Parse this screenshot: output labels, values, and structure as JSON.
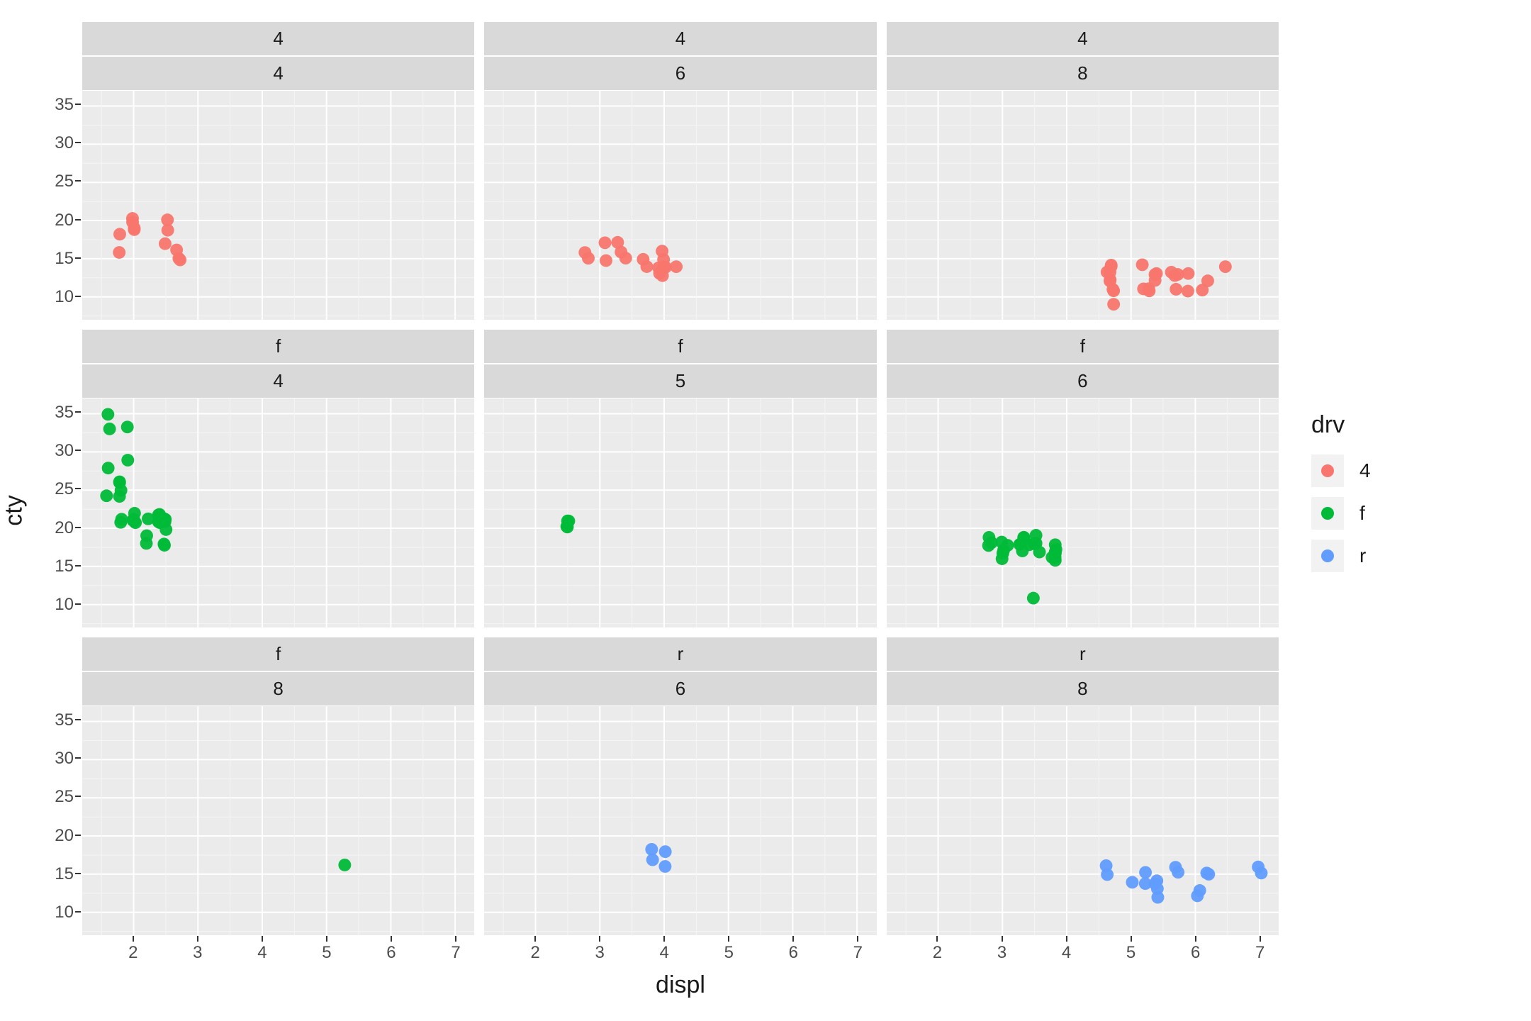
{
  "chart_data": {
    "type": "scatter",
    "xlabel": "displ",
    "ylabel": "cty",
    "xlim": [
      1.2,
      7.3
    ],
    "ylim": [
      7,
      37
    ],
    "x_ticks": [
      2,
      3,
      4,
      5,
      6,
      7
    ],
    "y_ticks": [
      10,
      15,
      20,
      25,
      30,
      35
    ],
    "colors": {
      "4": "#F8766D",
      "f": "#00BA38",
      "r": "#619CFF"
    },
    "legend": {
      "title": "drv",
      "items": [
        "4",
        "f",
        "r"
      ]
    },
    "facets": [
      {
        "row": 0,
        "col": 0,
        "strip": [
          "4",
          "4"
        ],
        "series": "4",
        "points": [
          {
            "x": 1.8,
            "y": 18
          },
          {
            "x": 1.8,
            "y": 16
          },
          {
            "x": 2.0,
            "y": 20
          },
          {
            "x": 2.0,
            "y": 19
          },
          {
            "x": 2.0,
            "y": 20
          },
          {
            "x": 2.0,
            "y": 19
          },
          {
            "x": 2.5,
            "y": 19
          },
          {
            "x": 2.5,
            "y": 20
          },
          {
            "x": 2.5,
            "y": 17
          },
          {
            "x": 2.7,
            "y": 15
          },
          {
            "x": 2.7,
            "y": 16
          },
          {
            "x": 2.7,
            "y": 15
          }
        ]
      },
      {
        "row": 0,
        "col": 1,
        "strip": [
          "4",
          "6"
        ],
        "series": "4",
        "points": [
          {
            "x": 2.8,
            "y": 15
          },
          {
            "x": 2.8,
            "y": 16
          },
          {
            "x": 3.1,
            "y": 15
          },
          {
            "x": 3.1,
            "y": 17
          },
          {
            "x": 3.3,
            "y": 17
          },
          {
            "x": 3.3,
            "y": 16
          },
          {
            "x": 3.4,
            "y": 15
          },
          {
            "x": 3.7,
            "y": 15
          },
          {
            "x": 3.7,
            "y": 14
          },
          {
            "x": 3.9,
            "y": 14
          },
          {
            "x": 3.9,
            "y": 13
          },
          {
            "x": 4.0,
            "y": 16
          },
          {
            "x": 4.0,
            "y": 14
          },
          {
            "x": 4.0,
            "y": 15
          },
          {
            "x": 4.0,
            "y": 14
          },
          {
            "x": 4.0,
            "y": 13
          },
          {
            "x": 4.2,
            "y": 14
          }
        ]
      },
      {
        "row": 0,
        "col": 2,
        "strip": [
          "4",
          "8"
        ],
        "series": "4",
        "points": [
          {
            "x": 4.6,
            "y": 13
          },
          {
            "x": 4.7,
            "y": 14
          },
          {
            "x": 4.7,
            "y": 13
          },
          {
            "x": 4.7,
            "y": 14
          },
          {
            "x": 4.7,
            "y": 9
          },
          {
            "x": 4.7,
            "y": 12
          },
          {
            "x": 4.7,
            "y": 11
          },
          {
            "x": 4.7,
            "y": 12
          },
          {
            "x": 4.7,
            "y": 11
          },
          {
            "x": 5.2,
            "y": 11
          },
          {
            "x": 5.2,
            "y": 14
          },
          {
            "x": 5.3,
            "y": 11
          },
          {
            "x": 5.3,
            "y": 11
          },
          {
            "x": 5.4,
            "y": 12
          },
          {
            "x": 5.4,
            "y": 13
          },
          {
            "x": 5.4,
            "y": 13
          },
          {
            "x": 5.6,
            "y": 13
          },
          {
            "x": 5.7,
            "y": 13
          },
          {
            "x": 5.7,
            "y": 11
          },
          {
            "x": 5.7,
            "y": 13
          },
          {
            "x": 5.9,
            "y": 11
          },
          {
            "x": 5.9,
            "y": 13
          },
          {
            "x": 6.1,
            "y": 11
          },
          {
            "x": 6.2,
            "y": 12
          },
          {
            "x": 6.5,
            "y": 14
          }
        ]
      },
      {
        "row": 1,
        "col": 0,
        "strip": [
          "f",
          "4"
        ],
        "series": "f",
        "points": [
          {
            "x": 1.6,
            "y": 24
          },
          {
            "x": 1.6,
            "y": 28
          },
          {
            "x": 1.6,
            "y": 33
          },
          {
            "x": 1.6,
            "y": 35
          },
          {
            "x": 1.8,
            "y": 21
          },
          {
            "x": 1.8,
            "y": 21
          },
          {
            "x": 1.8,
            "y": 24
          },
          {
            "x": 1.8,
            "y": 26
          },
          {
            "x": 1.8,
            "y": 25
          },
          {
            "x": 1.8,
            "y": 26
          },
          {
            "x": 1.9,
            "y": 29
          },
          {
            "x": 1.9,
            "y": 33
          },
          {
            "x": 2.0,
            "y": 21
          },
          {
            "x": 2.0,
            "y": 21
          },
          {
            "x": 2.0,
            "y": 22
          },
          {
            "x": 2.0,
            "y": 21
          },
          {
            "x": 2.0,
            "y": 21
          },
          {
            "x": 2.0,
            "y": 21
          },
          {
            "x": 2.2,
            "y": 21
          },
          {
            "x": 2.2,
            "y": 19
          },
          {
            "x": 2.2,
            "y": 18
          },
          {
            "x": 2.4,
            "y": 21
          },
          {
            "x": 2.4,
            "y": 22
          },
          {
            "x": 2.4,
            "y": 21
          },
          {
            "x": 2.4,
            "y": 21
          },
          {
            "x": 2.4,
            "y": 22
          },
          {
            "x": 2.5,
            "y": 20
          },
          {
            "x": 2.5,
            "y": 21
          },
          {
            "x": 2.5,
            "y": 18
          },
          {
            "x": 2.5,
            "y": 21
          },
          {
            "x": 2.5,
            "y": 21
          },
          {
            "x": 2.5,
            "y": 18
          }
        ]
      },
      {
        "row": 1,
        "col": 1,
        "strip": [
          "f",
          "5"
        ],
        "series": "f",
        "points": [
          {
            "x": 2.5,
            "y": 20
          },
          {
            "x": 2.5,
            "y": 21
          },
          {
            "x": 2.5,
            "y": 20
          },
          {
            "x": 2.5,
            "y": 21
          }
        ]
      },
      {
        "row": 1,
        "col": 2,
        "strip": [
          "f",
          "6"
        ],
        "series": "f",
        "points": [
          {
            "x": 2.8,
            "y": 18
          },
          {
            "x": 2.8,
            "y": 18
          },
          {
            "x": 2.8,
            "y": 19
          },
          {
            "x": 3.0,
            "y": 18
          },
          {
            "x": 3.0,
            "y": 17
          },
          {
            "x": 3.0,
            "y": 17
          },
          {
            "x": 3.0,
            "y": 16
          },
          {
            "x": 3.1,
            "y": 18
          },
          {
            "x": 3.3,
            "y": 18
          },
          {
            "x": 3.3,
            "y": 17
          },
          {
            "x": 3.3,
            "y": 19
          },
          {
            "x": 3.3,
            "y": 19
          },
          {
            "x": 3.3,
            "y": 18
          },
          {
            "x": 3.4,
            "y": 18
          },
          {
            "x": 3.5,
            "y": 19
          },
          {
            "x": 3.5,
            "y": 18
          },
          {
            "x": 3.5,
            "y": 18
          },
          {
            "x": 3.5,
            "y": 11
          },
          {
            "x": 3.6,
            "y": 17
          },
          {
            "x": 3.8,
            "y": 18
          },
          {
            "x": 3.8,
            "y": 16
          },
          {
            "x": 3.8,
            "y": 17
          },
          {
            "x": 3.8,
            "y": 17
          },
          {
            "x": 3.8,
            "y": 17
          },
          {
            "x": 3.8,
            "y": 16
          },
          {
            "x": 3.8,
            "y": 16
          },
          {
            "x": 3.8,
            "y": 17
          }
        ]
      },
      {
        "row": 2,
        "col": 0,
        "strip": [
          "f",
          "8"
        ],
        "series": "f",
        "points": [
          {
            "x": 5.3,
            "y": 16
          }
        ]
      },
      {
        "row": 2,
        "col": 1,
        "strip": [
          "r",
          "6"
        ],
        "series": "r",
        "points": [
          {
            "x": 3.8,
            "y": 18
          },
          {
            "x": 3.8,
            "y": 17
          },
          {
            "x": 4.0,
            "y": 16
          },
          {
            "x": 4.0,
            "y": 18
          }
        ]
      },
      {
        "row": 2,
        "col": 2,
        "strip": [
          "r",
          "8"
        ],
        "series": "r",
        "points": [
          {
            "x": 4.6,
            "y": 15
          },
          {
            "x": 4.6,
            "y": 16
          },
          {
            "x": 5.0,
            "y": 14
          },
          {
            "x": 5.2,
            "y": 15
          },
          {
            "x": 5.2,
            "y": 14
          },
          {
            "x": 5.4,
            "y": 14
          },
          {
            "x": 5.4,
            "y": 14
          },
          {
            "x": 5.4,
            "y": 13
          },
          {
            "x": 5.4,
            "y": 12
          },
          {
            "x": 5.7,
            "y": 16
          },
          {
            "x": 5.7,
            "y": 15
          },
          {
            "x": 6.0,
            "y": 12
          },
          {
            "x": 6.1,
            "y": 13
          },
          {
            "x": 6.2,
            "y": 15
          },
          {
            "x": 6.2,
            "y": 15
          },
          {
            "x": 7.0,
            "y": 15
          },
          {
            "x": 7.0,
            "y": 16
          }
        ]
      }
    ]
  }
}
